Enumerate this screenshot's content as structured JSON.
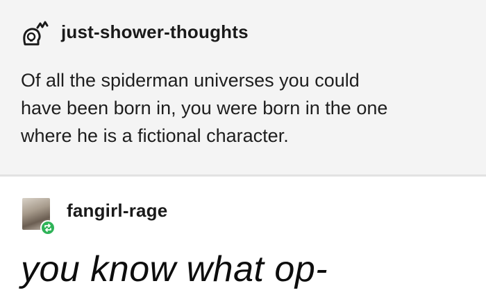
{
  "posts": [
    {
      "username": "just-shower-thoughts",
      "avatar_icon": "lightbulb-head-icon",
      "body_lines": [
        "Of all the spiderman universes you could",
        "have been born in, you were born in the one",
        "where he is a fictional character."
      ]
    },
    {
      "username": "fangirl-rage",
      "avatar_icon": "user-photo-avatar",
      "badge_icon": "reblog-icon",
      "badge_color": "#2fb358",
      "body": "you know what op-"
    }
  ]
}
